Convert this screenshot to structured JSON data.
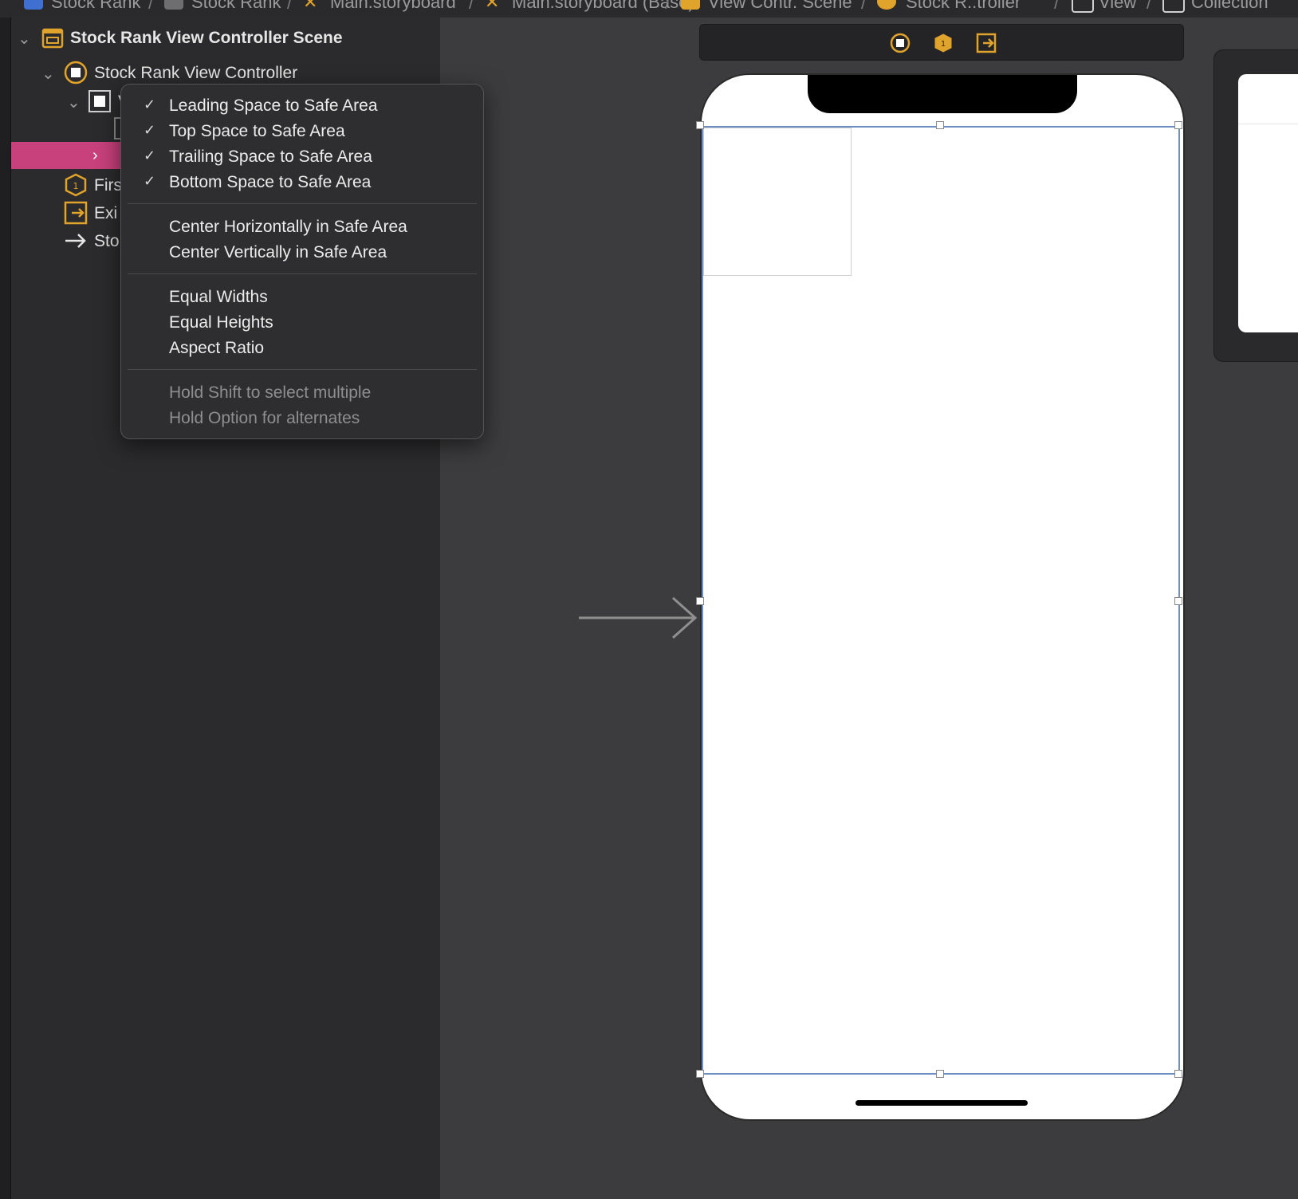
{
  "breadcrumb": {
    "items": [
      "Stock Rank",
      "Stock Rank",
      "Main.storyboard",
      "Main.storyboard (Base)",
      "View Contr. Scene",
      "Stock R..troller",
      "View",
      "Collection"
    ]
  },
  "navigator": {
    "scene_title": "Stock Rank View Controller Scene",
    "controller": "Stock Rank View Controller",
    "view_partial": "Vi",
    "first_responder_partial": "Firs",
    "exit_partial": "Exi",
    "storyboard_partial": "Sto",
    "selected_row_color": "#c8407c"
  },
  "menu": {
    "title_items": [
      {
        "label": "Leading Space to Safe Area",
        "checked": true
      },
      {
        "label": "Top Space to Safe Area",
        "checked": true
      },
      {
        "label": "Trailing Space to Safe Area",
        "checked": true
      },
      {
        "label": "Bottom Space to Safe Area",
        "checked": true
      }
    ],
    "center_items": [
      "Center Horizontally in Safe Area",
      "Center Vertically in Safe Area"
    ],
    "size_items": [
      "Equal Widths",
      "Equal Heights",
      "Aspect Ratio"
    ],
    "hints": [
      "Hold Shift to select multiple",
      "Hold Option for alternates"
    ],
    "check_glyph": "✓"
  },
  "icons": {
    "scene": "storyboard-scene-icon",
    "view_controller": "view-controller-icon",
    "first_responder": "first-responder-icon",
    "exit": "exit-icon",
    "entry_point": "arrow-right-icon",
    "accent_color": "#e0a32b"
  }
}
